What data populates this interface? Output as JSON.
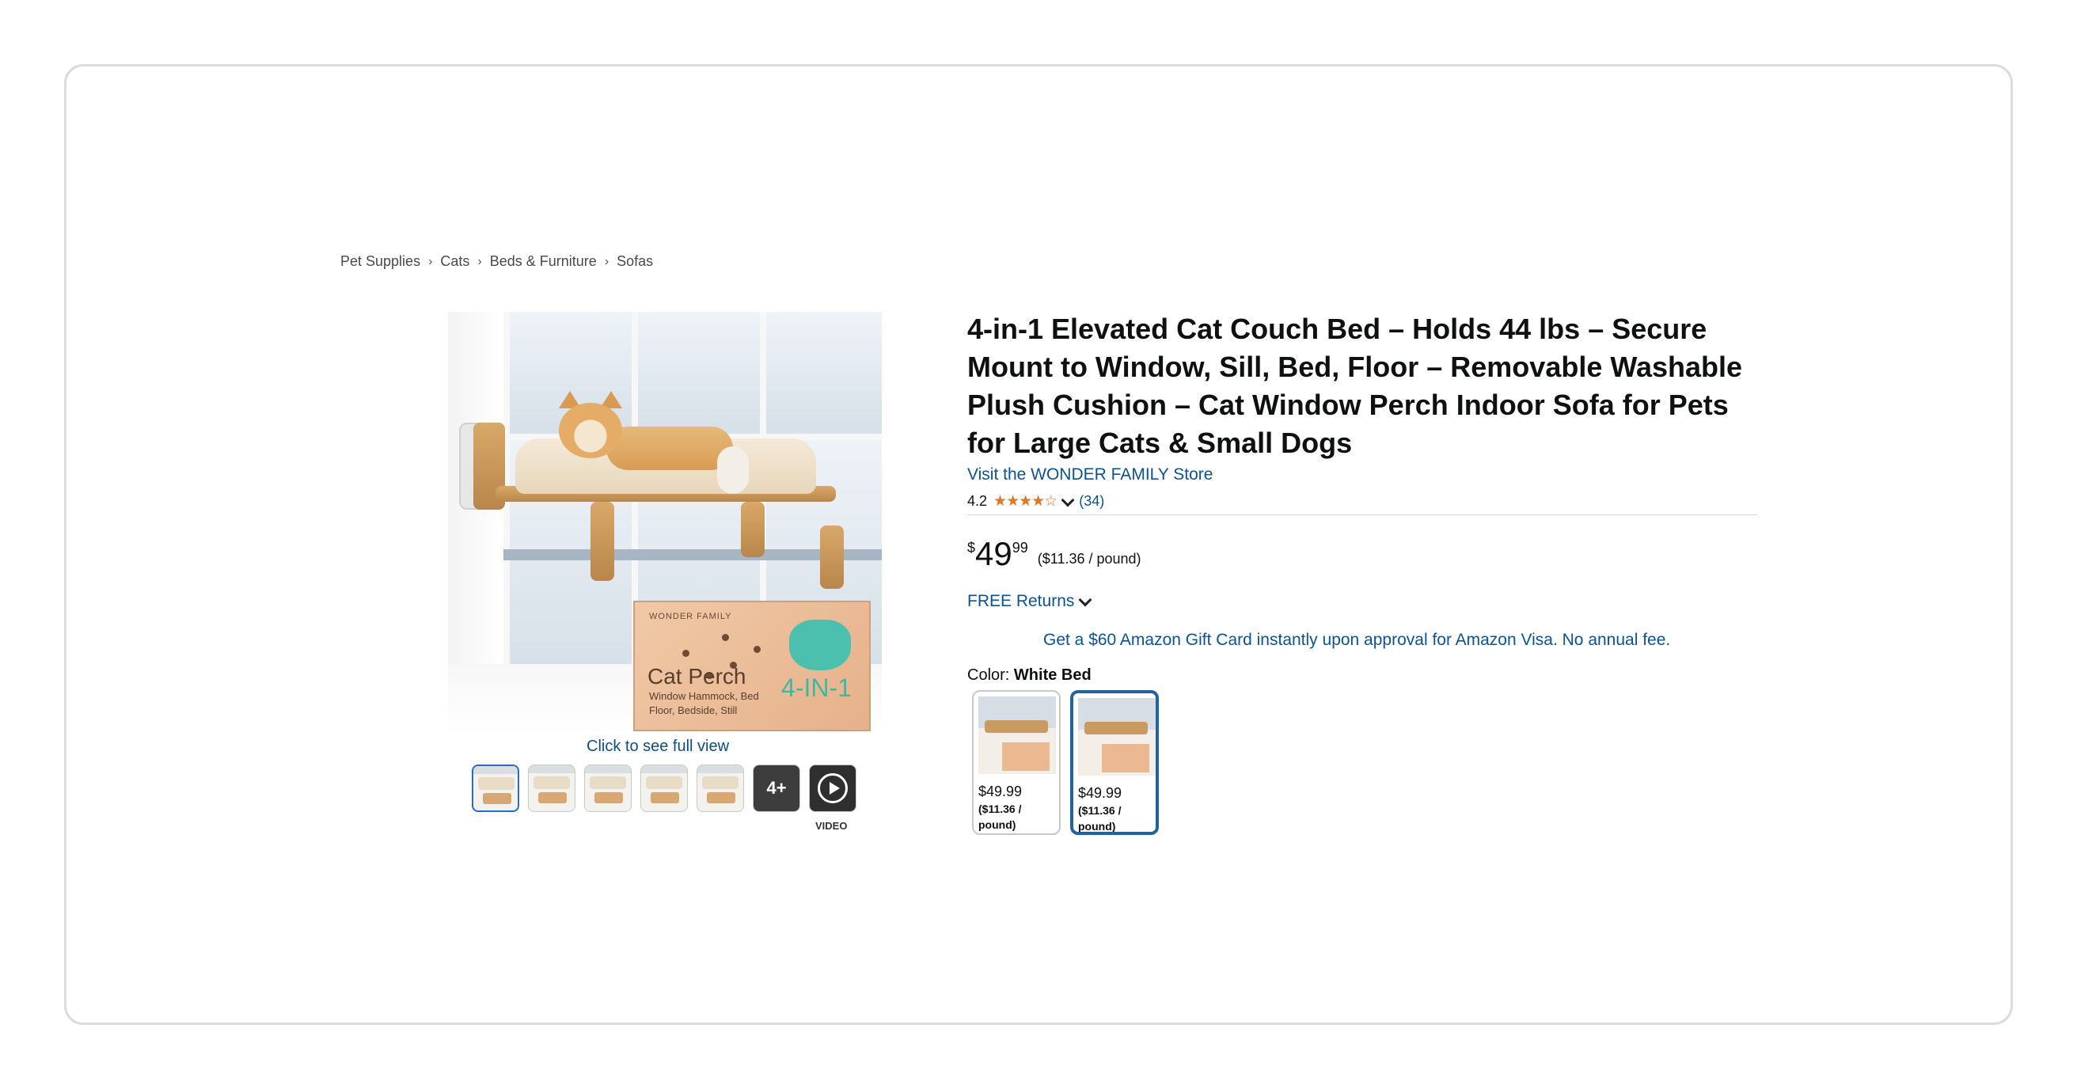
{
  "breadcrumb": [
    "Pet Supplies",
    "Cats",
    "Beds & Furniture",
    "Sofas"
  ],
  "gallery": {
    "box_brand": "WONDER FAMILY",
    "box_title": "Cat Perch",
    "box_sub": "Window Hammock, Bed Floor, Bedside, Still",
    "box_big": "4-IN-1",
    "full_view": "Click to see full view",
    "more_label": "4+",
    "video_label": "VIDEO"
  },
  "product": {
    "title": "4-in-1 Elevated Cat Couch Bed – Holds 44 lbs – Secure Mount to Window, Sill, Bed, Floor – Removable Washable Plush Cushion – Cat Window Perch Indoor Sofa for Pets for Large Cats & Small Dogs",
    "store": "Visit the WONDER FAMILY Store",
    "rating": "4.2",
    "stars": "★★★★☆",
    "review_count": "(34)",
    "price_symbol": "$",
    "price_whole": "49",
    "price_fraction": "99",
    "unit_price": "($11.36 / pound)",
    "returns": "FREE Returns",
    "promo": "Get a $60 Amazon Gift Card instantly upon approval for Amazon Visa. No annual fee.",
    "color_label": "Color:",
    "color_value": "White Bed"
  },
  "swatches": [
    {
      "price": "$49.99",
      "unit": "($11.36 / pound)"
    },
    {
      "price": "$49.99",
      "unit": "($11.36 / pound)"
    }
  ],
  "colors": {
    "link": "#0b5394",
    "star": "#de7921",
    "selected": "#2162a1"
  }
}
